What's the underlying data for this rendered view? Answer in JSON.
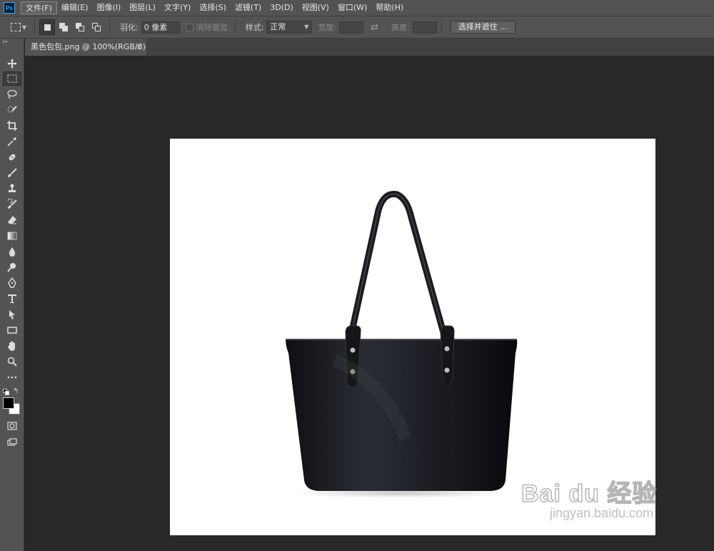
{
  "app": {
    "logo_text": "Ps"
  },
  "menu": [
    {
      "label": "文件(F)",
      "active": true
    },
    {
      "label": "编辑(E)"
    },
    {
      "label": "图像(I)"
    },
    {
      "label": "图层(L)"
    },
    {
      "label": "文字(Y)"
    },
    {
      "label": "选择(S)"
    },
    {
      "label": "滤镜(T)"
    },
    {
      "label": "3D(D)"
    },
    {
      "label": "视图(V)"
    },
    {
      "label": "窗口(W)"
    },
    {
      "label": "帮助(H)"
    }
  ],
  "options": {
    "feather_label": "羽化:",
    "feather_value": "0 像素",
    "antialias_label": "消除锯齿",
    "style_label": "样式:",
    "style_value": "正常",
    "width_label": "宽度:",
    "height_label": "高度:",
    "select_mask_label": "选择并遮住 ..."
  },
  "tabs": [
    {
      "label": "黑色包包.png @ 100%(RGB/8)",
      "close": "×"
    }
  ],
  "tools": [
    {
      "name": "move-tool-icon"
    },
    {
      "name": "rect-marquee-tool-icon",
      "active": true
    },
    {
      "name": "lasso-tool-icon"
    },
    {
      "name": "quick-select-tool-icon"
    },
    {
      "name": "crop-tool-icon"
    },
    {
      "name": "eyedropper-tool-icon"
    },
    {
      "name": "healing-brush-tool-icon"
    },
    {
      "name": "brush-tool-icon"
    },
    {
      "name": "clone-stamp-tool-icon"
    },
    {
      "name": "history-brush-tool-icon"
    },
    {
      "name": "eraser-tool-icon"
    },
    {
      "name": "gradient-tool-icon"
    },
    {
      "name": "blur-tool-icon"
    },
    {
      "name": "dodge-tool-icon"
    },
    {
      "name": "pen-tool-icon"
    },
    {
      "name": "type-tool-icon"
    },
    {
      "name": "path-select-tool-icon"
    },
    {
      "name": "rectangle-tool-icon"
    },
    {
      "name": "hand-tool-icon"
    },
    {
      "name": "zoom-tool-icon"
    },
    {
      "name": "more-tools-icon"
    }
  ],
  "colors": {
    "foreground": "#000000",
    "background": "#ffffff",
    "accent": "#31a8ff"
  },
  "watermark": {
    "logo": "Bai du 经验",
    "url": "jingyan.baidu.com"
  }
}
